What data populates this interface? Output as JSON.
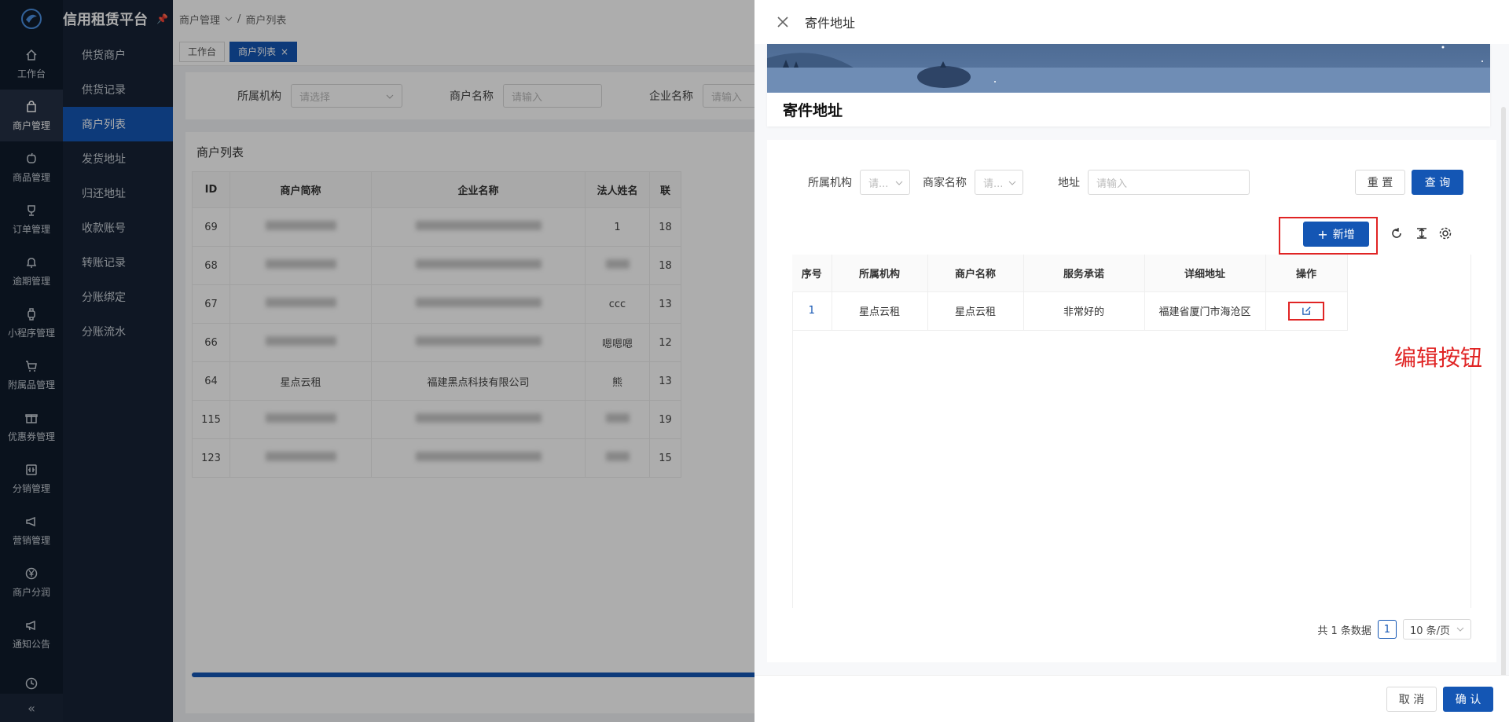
{
  "app": {
    "title": "信用租赁平台"
  },
  "rail": {
    "items": [
      {
        "label": "工作台",
        "icon": "home-icon"
      },
      {
        "label": "商户管理",
        "icon": "bag-icon"
      },
      {
        "label": "商品管理",
        "icon": "apple-icon"
      },
      {
        "label": "订单管理",
        "icon": "trophy-icon"
      },
      {
        "label": "逾期管理",
        "icon": "bell-icon"
      },
      {
        "label": "小程序管理",
        "icon": "watch-icon"
      },
      {
        "label": "附属品管理",
        "icon": "cart-icon"
      },
      {
        "label": "优惠券管理",
        "icon": "gift-icon"
      },
      {
        "label": "分销管理",
        "icon": "distribution-icon"
      },
      {
        "label": "营销管理",
        "icon": "megaphone-icon"
      },
      {
        "label": "商户分润",
        "icon": "yen-icon"
      },
      {
        "label": "通知公告",
        "icon": "notice-icon"
      },
      {
        "label": "",
        "icon": "clock-icon"
      }
    ],
    "collapse": "«"
  },
  "submenu": {
    "items": [
      "供货商户",
      "供货记录",
      "商户列表",
      "发货地址",
      "归还地址",
      "收款账号",
      "转账记录",
      "分账绑定",
      "分账流水"
    ]
  },
  "breadcrumb": {
    "parent": "商户管理",
    "sep": "/",
    "current": "商户列表"
  },
  "tabs": [
    {
      "label": "工作台"
    },
    {
      "label": "商户列表",
      "close": "×"
    }
  ],
  "filters": [
    {
      "label": "所属机构",
      "placeholder": "请选择"
    },
    {
      "label": "商户名称",
      "placeholder": "请输入"
    },
    {
      "label": "企业名称",
      "placeholder": "请输入"
    }
  ],
  "merchant_list": {
    "title": "商户列表",
    "columns": [
      "ID",
      "商户简称",
      "企业名称",
      "法人姓名",
      "联"
    ],
    "rows": [
      {
        "id": "69",
        "short": "",
        "company": "",
        "legal": "1",
        "phone": "18"
      },
      {
        "id": "68",
        "short": "",
        "company": "",
        "legal": "",
        "phone": "18"
      },
      {
        "id": "67",
        "short": "",
        "company": "",
        "legal": "ccc",
        "phone": "13"
      },
      {
        "id": "66",
        "short": "",
        "company": "",
        "legal": "嗯嗯嗯",
        "phone": "12"
      },
      {
        "id": "64",
        "short": "星点云租",
        "company": "福建黑点科技有限公司",
        "legal": "熊",
        "phone": "13"
      },
      {
        "id": "115",
        "short": "",
        "company": "",
        "legal": "",
        "phone": "19"
      },
      {
        "id": "123",
        "short": "",
        "company": "",
        "legal": "",
        "phone": "15"
      }
    ]
  },
  "drawer": {
    "title": "寄件地址",
    "banner_title": "寄件地址",
    "filters": [
      {
        "label": "所属机构",
        "placeholder": "请..."
      },
      {
        "label": "商家名称",
        "placeholder": "请..."
      },
      {
        "label": "地址",
        "placeholder": "请输入"
      }
    ],
    "reset_label": "重 置",
    "query_label": "查 询",
    "add_label": "新增",
    "columns": [
      "序号",
      "所属机构",
      "商户名称",
      "服务承诺",
      "详细地址",
      "操作"
    ],
    "rows": [
      {
        "index": "1",
        "org": "星点云租",
        "merchant": "星点云租",
        "promise": "非常好的",
        "address": "福建省厦门市海沧区"
      }
    ],
    "annotation": "编辑按钮",
    "pager": {
      "total": "共 1 条数据",
      "page": "1",
      "size": "10 条/页"
    },
    "cancel_label": "取 消",
    "confirm_label": "确 认"
  },
  "colors": {
    "primary": "#1456b4",
    "sidebar": "#0f1b2c",
    "submenu": "#172335",
    "annotation": "#e02424"
  }
}
